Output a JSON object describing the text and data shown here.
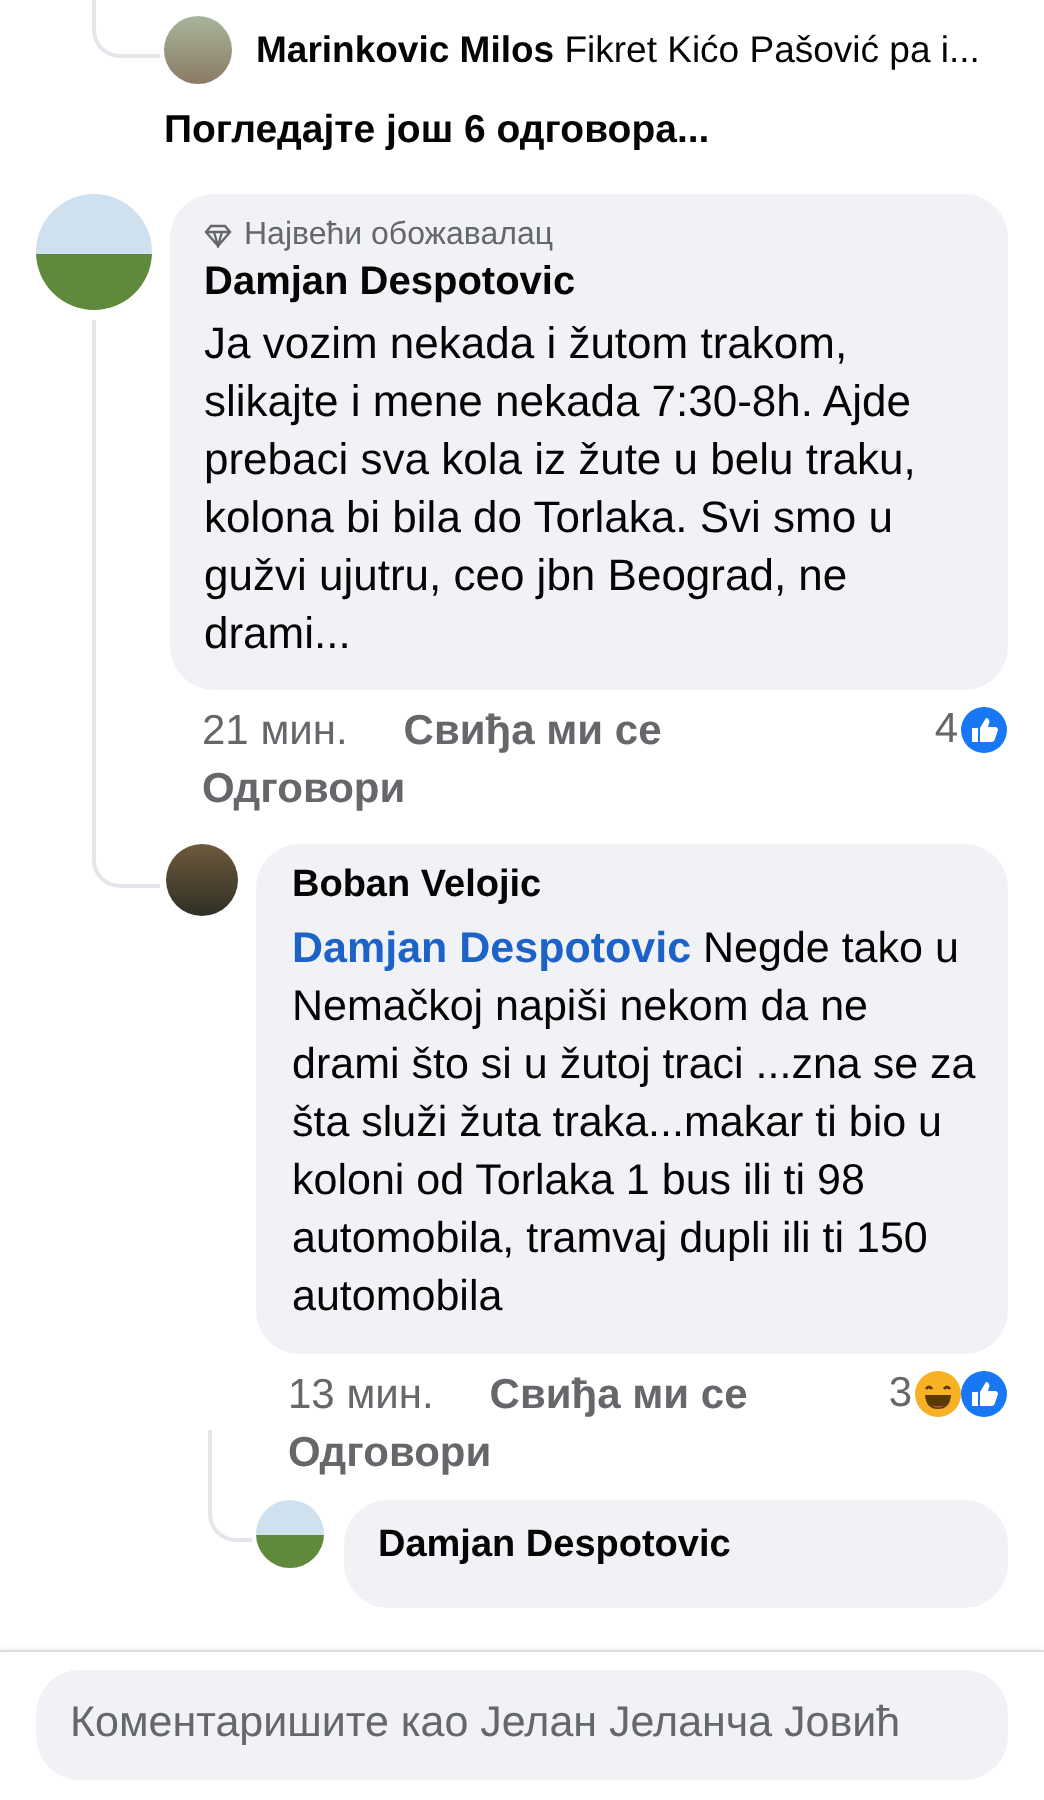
{
  "collapsed_thread": {
    "reply": {
      "author": "Marinkovic Milos",
      "text": "Fikret Kićo Pašović pa i..."
    },
    "more_replies_link": "Погледајте још 6 одговора..."
  },
  "comments": [
    {
      "badge": "Највећи обожавалац",
      "author": "Damjan Despotovic",
      "text": "Ja vozim nekada i žutom trakom, slikajte i mene nekada 7:30-8h. Ajde prebaci sva kola iz žute u belu traku, kolona bi bila do Torlaka. Svi smo u gužvi ujutru, ceo jbn Beograd, ne drami...",
      "time": "21 мин.",
      "like_label": "Свиђа ми се",
      "reply_label": "Одговори",
      "reaction_count": "4",
      "reactions": [
        {
          "kind": "like"
        }
      ],
      "replies": [
        {
          "author": "Boban Velojic",
          "mention": "Damjan Despotovic",
          "text": "Negde tako u Nemačkoj napiši nekom da ne drami što si u žutoj traci ...zna se za šta služi žuta traka...makar ti bio u koloni od Torlaka 1 bus ili ti 98 automobila, tramvaj dupli ili ti 150 automobila",
          "time": "13 мин.",
          "like_label": "Свиђа ми се",
          "reply_label": "Одговори",
          "reaction_count": "3",
          "reactions": [
            {
              "kind": "haha"
            },
            {
              "kind": "like"
            }
          ],
          "replies": [
            {
              "author": "Damjan Despotovic"
            }
          ]
        }
      ]
    }
  ],
  "composer": {
    "placeholder": "Коментаришите као Јелан Јеланча Јовић"
  }
}
